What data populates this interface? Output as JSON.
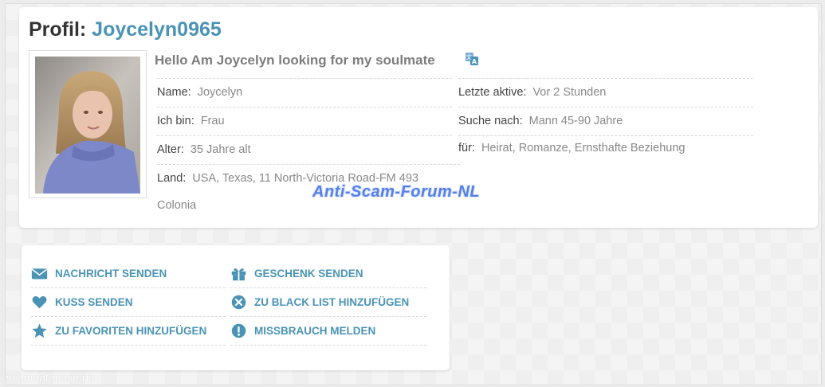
{
  "profile": {
    "title_prefix": "Profil:",
    "username": "Joycelyn0965",
    "tagline": "Hello Am Joycelyn looking for my soulmate",
    "fields_left": [
      {
        "label": "Name:",
        "value": "Joycelyn"
      },
      {
        "label": "Ich bin:",
        "value": "Frau"
      },
      {
        "label": "Alter:",
        "value": "35 Jahre alt"
      },
      {
        "label": "Land:",
        "value": "USA, Texas, 11 North-Victoria Road-FM 493"
      }
    ],
    "land_continuation": "Colonia",
    "fields_right": [
      {
        "label": "Letzte aktive:",
        "value": "Vor 2 Stunden"
      },
      {
        "label": "Suche nach:",
        "value": "Mann 45-90 Jahre"
      },
      {
        "label": "für:",
        "value": "Heirat, Romanze, Ernsthafte Beziehung"
      }
    ]
  },
  "watermark": "Anti-Scam-Forum-NL",
  "bottom_watermark": "scamdatabase.de",
  "actions": {
    "send_message": "NACHRICHT SENDEN",
    "send_gift": "GESCHENK SENDEN",
    "send_kiss": "KUSS SENDEN",
    "add_blacklist": "ZU BLACK LIST HINZUFÜGEN",
    "add_favorites": "ZU FAVORITEN HINZUFÜGEN",
    "report_abuse": "MISSBRAUCH MELDEN"
  },
  "colors": {
    "accent": "#4a93b5",
    "heading": "#333333",
    "muted": "#888888",
    "watermark": "#5580e6"
  }
}
